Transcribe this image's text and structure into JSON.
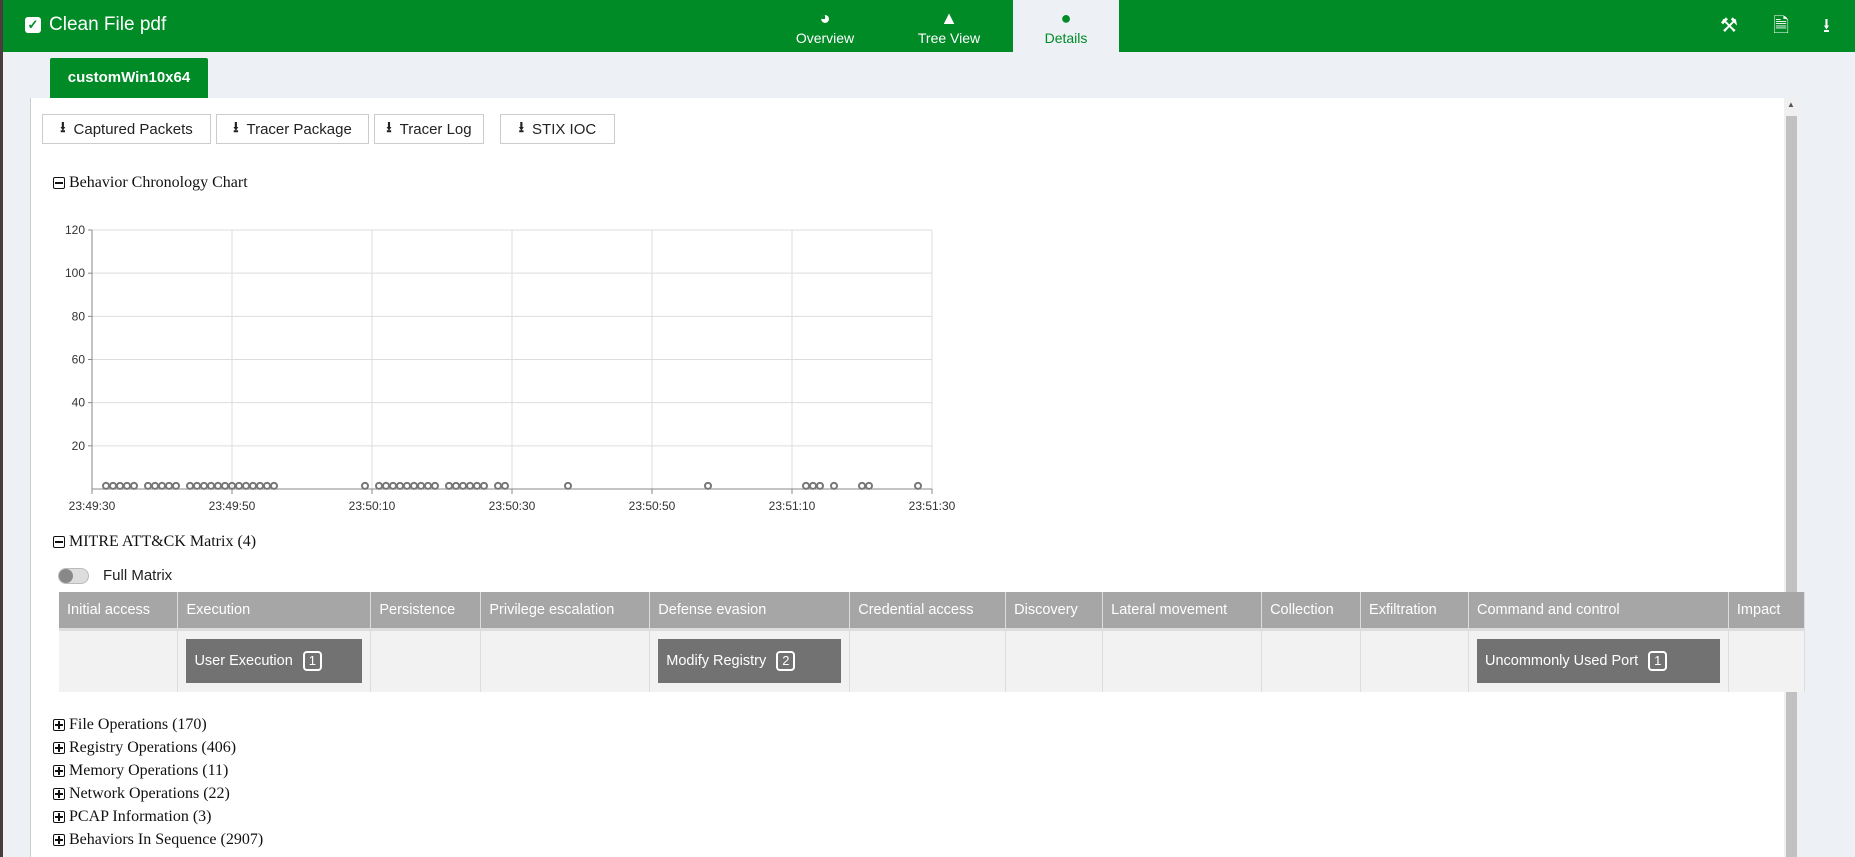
{
  "header": {
    "title": "Clean File pdf",
    "tabs": [
      {
        "label": "Overview",
        "icon": "dashboard-icon"
      },
      {
        "label": "Tree View",
        "icon": "tree-icon"
      },
      {
        "label": "Details",
        "icon": "spy-icon",
        "active": true
      }
    ],
    "actions": [
      "hammer-icon",
      "pdf-icon",
      "download-icon"
    ]
  },
  "vm_tab": "customWin10x64",
  "downloads": [
    "Captured Packets",
    "Tracer Package",
    "Tracer Log",
    "STIX IOC"
  ],
  "chart_section": "Behavior Chronology Chart",
  "chart_data": {
    "type": "scatter",
    "ylim": [
      0,
      120
    ],
    "yticks": [
      "20",
      "40",
      "60",
      "80",
      "100",
      "120"
    ],
    "xticks": [
      "23:49:30",
      "23:49:50",
      "23:50:10",
      "23:50:30",
      "23:50:50",
      "23:51:10",
      "23:51:30"
    ],
    "grid": true,
    "points_x": [
      "23:49:32",
      "23:49:33",
      "23:49:34",
      "23:49:35",
      "23:49:36",
      "23:49:38",
      "23:49:39",
      "23:49:40",
      "23:49:41",
      "23:49:42",
      "23:49:44",
      "23:49:45",
      "23:49:46",
      "23:49:47",
      "23:49:48",
      "23:49:49",
      "23:49:50",
      "23:49:51",
      "23:49:52",
      "23:49:53",
      "23:49:54",
      "23:49:55",
      "23:49:56",
      "23:50:09",
      "23:50:11",
      "23:50:12",
      "23:50:13",
      "23:50:14",
      "23:50:15",
      "23:50:16",
      "23:50:17",
      "23:50:18",
      "23:50:19",
      "23:50:21",
      "23:50:22",
      "23:50:23",
      "23:50:24",
      "23:50:25",
      "23:50:26",
      "23:50:28",
      "23:50:29",
      "23:50:38",
      "23:50:58",
      "23:51:12",
      "23:51:13",
      "23:51:14",
      "23:51:16",
      "23:51:20",
      "23:51:21",
      "23:51:28"
    ],
    "y_value": 1
  },
  "mitre": {
    "title": "MITRE ATT&CK Matrix (4)",
    "toggle_label": "Full Matrix",
    "toggle_on": false,
    "columns": [
      "Initial access",
      "Execution",
      "Persistence",
      "Privilege escalation",
      "Defense evasion",
      "Credential access",
      "Discovery",
      "Lateral movement",
      "Collection",
      "Exfiltration",
      "Command and control",
      "Impact"
    ],
    "techniques": {
      "1": {
        "name": "User Execution",
        "count": "1"
      },
      "4": {
        "name": "Modify Registry",
        "count": "2"
      },
      "10": {
        "name": "Uncommonly Used Port",
        "count": "1"
      }
    }
  },
  "sections": [
    "File Operations (170)",
    "Registry Operations (406)",
    "Memory Operations (11)",
    "Network Operations (22)",
    "PCAP Information (3)",
    "Behaviors In Sequence (2907)"
  ]
}
